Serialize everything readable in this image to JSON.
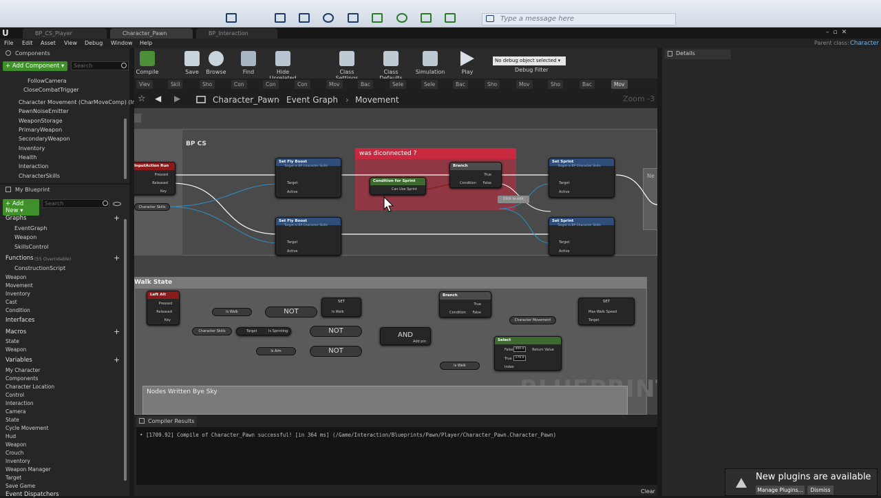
{
  "system": {
    "message_placeholder": "Type a message here"
  },
  "tabs": [
    "BP_CS_Player",
    "Character_Pawn",
    "BP_Interaction"
  ],
  "window": {
    "parent_class_label": "Parent class:",
    "parent_class_value": "Character"
  },
  "menu": [
    "File",
    "Edit",
    "Asset",
    "View",
    "Debug",
    "Window",
    "Help"
  ],
  "components": {
    "title": "Components",
    "add_label": "+ Add Component ▾",
    "search_placeholder": "Search",
    "items": [
      "FollowCamera",
      "CloseCombatTrigger",
      "Character Movement (CharMoveComp) (Ir",
      "PawnNoiseEmitter",
      "WeaponStorage",
      "PrimaryWeapon",
      "SecondaryWeapon",
      "Inventory",
      "Health",
      "Interaction",
      "CharacterSkills"
    ]
  },
  "my_blueprint": {
    "title": "My Blueprint",
    "add_label": "+ Add New ▾",
    "search_placeholder": "Search",
    "graphs_label": "Graphs",
    "graphs": [
      "EventGraph",
      "Weapon",
      "SkillsControl"
    ],
    "functions_label": "Functions",
    "functions_count": "(55 Overridable)",
    "functions": [
      "ConstructionScript"
    ],
    "function_groups": [
      "Weapon",
      "Movement",
      "Inventory",
      "Cast",
      "Condition"
    ],
    "interfaces_label": "Interfaces",
    "macros_label": "Macros",
    "macros": [
      "State",
      "Weapon"
    ],
    "variables_label": "Variables",
    "variables": [
      "My Character",
      "Components",
      "Character Location",
      "Control",
      "Interaction",
      "Camera",
      "State",
      "Cycle Movement",
      "Hud",
      "Weapon",
      "Crouch",
      "Inventory",
      "Weapon Manager",
      "Target",
      "Save Game"
    ],
    "dispatchers_label": "Event Dispatchers"
  },
  "toolbar": {
    "buttons": [
      "Compile",
      "Save",
      "Browse",
      "Find",
      "Hide Unrelated",
      "Class Settings",
      "Class Defaults",
      "Simulation",
      "Play"
    ],
    "debug_select": "No debug object selected ▾",
    "debug_filter": "Debug Filter"
  },
  "graph_tabs": [
    "Viev",
    "Skil",
    "Sho",
    "Con",
    "Con",
    "Con",
    "Mov",
    "Bac",
    "Sele",
    "Sele",
    "Bac",
    "Sho",
    "Mov",
    "Sho",
    "Bac",
    "Mov"
  ],
  "breadcrumb": {
    "root": "Character_Pawn",
    "graph": "Event Graph",
    "current": "Movement",
    "zoom": "Zoom -3"
  },
  "graph": {
    "comment_top": "BP CS",
    "comment_disconnected": "was diconnected ?",
    "comment_walk": "Walk State",
    "comment_bottom": "Nodes Written Bye Sky",
    "watermark": "BLUEPRINT",
    "node_input_action": "InputAction Run",
    "pin_pressed": "Pressed",
    "pin_released": "Released",
    "pin_key": "Key",
    "var_character_skills": "Character Skills",
    "node_set_fly_boost": "Set Fly Boost",
    "node_subtitle": "Target is BP Character Skills",
    "pin_target": "Target",
    "pin_active": "Active",
    "node_condition": "Condition for Sprint",
    "pin_can_use_sprint": "Can Use Sprint",
    "node_branch": "Branch",
    "pin_condition": "Condition",
    "pin_true": "True",
    "pin_false": "False",
    "node_set_sprint": "Set Sprint",
    "click_to_edit": "Click to edit",
    "node_ne": "Ne",
    "node_left_alt": "Left Alt",
    "var_is_walk": "Is Walk",
    "op_not": "NOT",
    "op_and": "AND",
    "add_pin": "Add pin",
    "set_label": "SET",
    "var_is_sprinting": "Is Sprinting",
    "var_is_aim": "Is Aim",
    "var_character_movement": "Character Movement",
    "pin_max_walk_speed": "Max Walk Speed",
    "node_select": "Select",
    "pin_return_value": "Return Value",
    "select_false_value": "400.0",
    "select_true_value": "170.0",
    "pin_index": "Index"
  },
  "compiler": {
    "tab": "Compiler Results",
    "log": "• [1709.92] Compile of Character_Pawn successful! [in 364 ms] (/Game/Interaction/Blueprints/Pawn/Player/Character_Pawn.Character_Pawn)",
    "clear": "Clear"
  },
  "details": {
    "title": "Details"
  },
  "notification": {
    "title": "New plugins are available",
    "manage": "Manage Plugins...",
    "dismiss": "Dismiss"
  },
  "colors": {
    "accent_green": "#3f8f2a",
    "comment_red": "#c8293e",
    "exec_white": "#ffffff",
    "object_blue": "#2d8fc8",
    "bool_red": "#8b1a1a"
  }
}
